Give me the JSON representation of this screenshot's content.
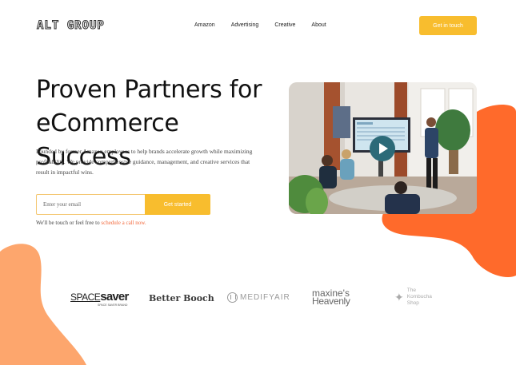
{
  "nav": {
    "logo": "ALT GROUP",
    "links": [
      "Amazon",
      "Advertising",
      "Creative",
      "About"
    ],
    "cta": "Get in touch"
  },
  "hero": {
    "title_line1": "Proven Partners for",
    "title_line2": "eCommerce Success",
    "description": "Founded by former Amazon employees to help brands accelerate growth while maximizing profitability.  We provide comprehensive guidance, management, and creative services that result in impactful wins.",
    "email_placeholder": "Enter your email",
    "start_button": "Get started",
    "note_prefix": "We'll be touch or feel free to ",
    "note_link": "schedule a call now."
  },
  "video": {
    "play_icon": "play-icon"
  },
  "logos": {
    "spacesaver_a": "SPACE",
    "spacesaver_b": "saver",
    "spacesaver_sub": "SPACE SAVER BRAND",
    "betterbooch": "Better Booch",
    "medifyair": "MEDIFYAIR",
    "maxines_1": "maxine's",
    "maxines_2": "Heavenly",
    "kombucha_1": "The",
    "kombucha_2": "Kombucha",
    "kombucha_3": "Shop"
  },
  "colors": {
    "accent_yellow": "#f8bd2e",
    "blob_orange": "#ff6a2b",
    "blob_peach": "#fda66d",
    "link_orange": "#f26a3d"
  }
}
